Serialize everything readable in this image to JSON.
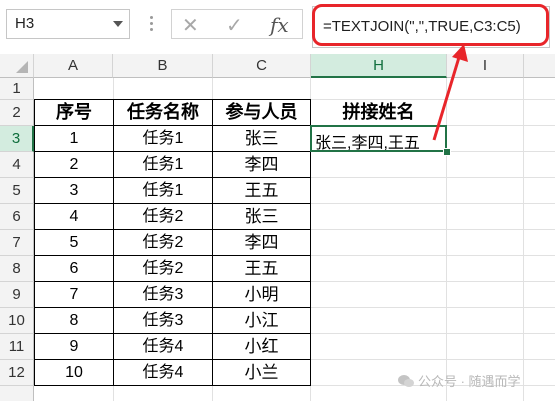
{
  "name_box": "H3",
  "formula_bar": {
    "cancel_symbol": "✕",
    "enter_symbol": "✓",
    "fx_label": "fx",
    "formula": "=TEXTJOIN(\",\",TRUE,C3:C5)"
  },
  "columns": [
    "A",
    "B",
    "C",
    "H",
    "I"
  ],
  "rows": [
    "1",
    "2",
    "3",
    "4",
    "5",
    "6",
    "7",
    "8",
    "9",
    "10",
    "11",
    "12"
  ],
  "headers": {
    "col_a": "序号",
    "col_b": "任务名称",
    "col_c": "参与人员",
    "col_h": "拼接姓名"
  },
  "table": [
    [
      "1",
      "任务1",
      "张三"
    ],
    [
      "2",
      "任务1",
      "李四"
    ],
    [
      "3",
      "任务1",
      "王五"
    ],
    [
      "4",
      "任务2",
      "张三"
    ],
    [
      "5",
      "任务2",
      "李四"
    ],
    [
      "6",
      "任务2",
      "王五"
    ],
    [
      "7",
      "任务3",
      "小明"
    ],
    [
      "8",
      "任务3",
      "小江"
    ],
    [
      "9",
      "任务4",
      "小红"
    ],
    [
      "10",
      "任务4",
      "小兰"
    ]
  ],
  "h3_value": "张三,李四,王五",
  "watermark": "公众号 · 随遇而学",
  "colors": {
    "highlight": "#e8252a",
    "selection": "#217346"
  }
}
